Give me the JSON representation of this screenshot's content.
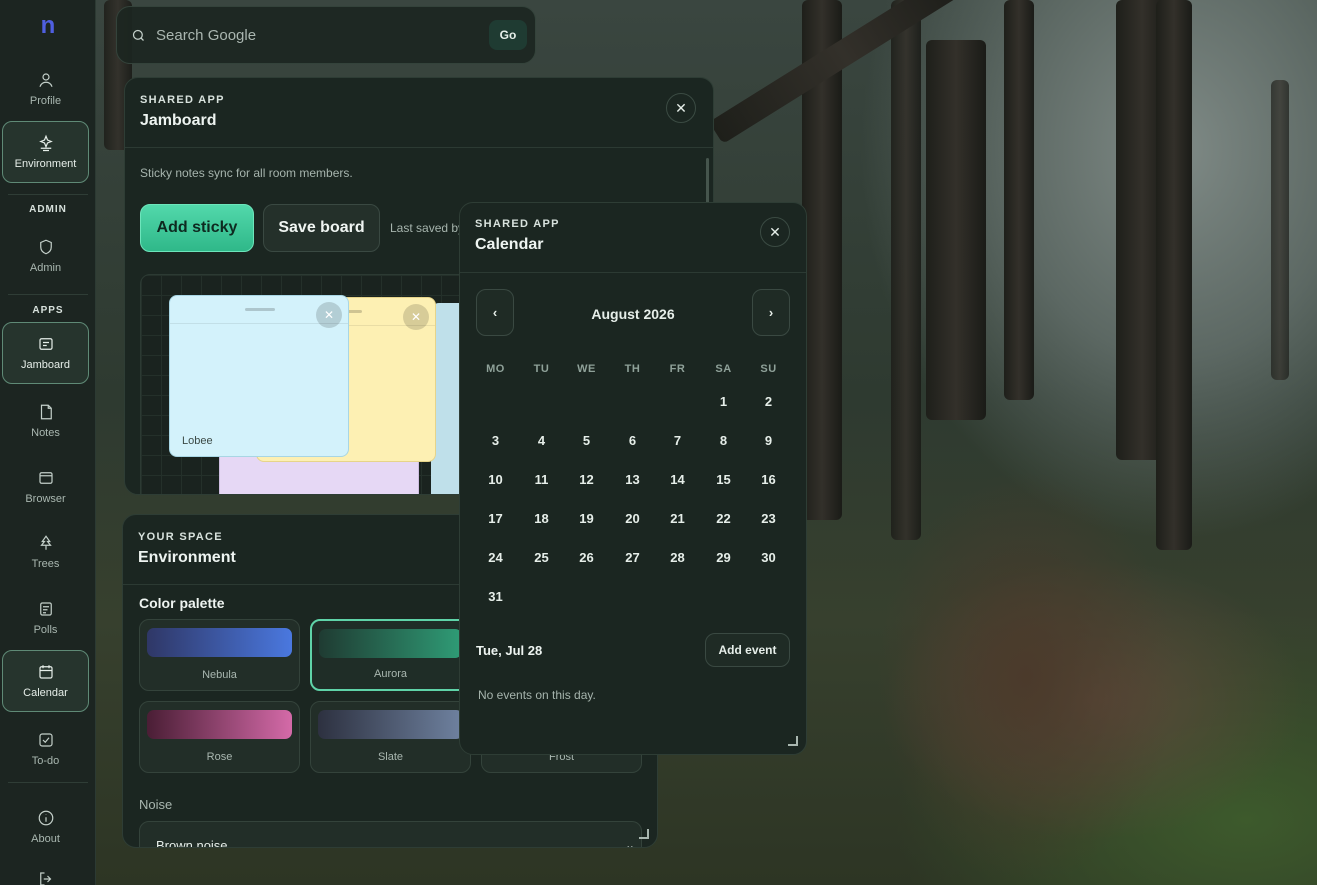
{
  "sidebar": {
    "logo": "n",
    "items": [
      {
        "label": "Profile",
        "icon": "user-icon"
      },
      {
        "label": "Environment",
        "icon": "sparkle-lamp-icon"
      },
      {
        "label": "Admin",
        "icon": "shield-icon"
      },
      {
        "label": "Jamboard",
        "icon": "board-icon"
      },
      {
        "label": "Notes",
        "icon": "note-icon"
      },
      {
        "label": "Browser",
        "icon": "browser-icon"
      },
      {
        "label": "Trees",
        "icon": "tree-icon"
      },
      {
        "label": "Polls",
        "icon": "poll-icon"
      },
      {
        "label": "Calendar",
        "icon": "calendar-icon"
      },
      {
        "label": "To-do",
        "icon": "checkbox-icon"
      },
      {
        "label": "About",
        "icon": "info-icon"
      }
    ],
    "sections": {
      "admin": "ADMIN",
      "apps": "APPS"
    }
  },
  "search": {
    "placeholder": "Search Google",
    "value": "",
    "go_label": "Go"
  },
  "jamboard": {
    "kicker": "SHARED APP",
    "title": "Jamboard",
    "description": "Sticky notes sync for all room members.",
    "add_label": "Add sticky",
    "save_label": "Save board",
    "last_saved": "Last saved by",
    "stickies": [
      {
        "author": "Lobee",
        "color": "#d3f2fb"
      },
      {
        "author": "",
        "color": "#fdf0b3"
      },
      {
        "author": "",
        "color": "#bfe0ea"
      },
      {
        "author": "",
        "color": "#e6d8f5"
      }
    ]
  },
  "environment": {
    "kicker": "YOUR SPACE",
    "title": "Environment",
    "palette_title": "Color palette",
    "palettes": [
      {
        "name": "Nebula",
        "from": "#2f3766",
        "to": "#4a78df",
        "selected": false
      },
      {
        "name": "Aurora",
        "from": "#1f3b32",
        "to": "#2f9c76",
        "selected": true
      },
      {
        "name": "",
        "from": "#2a3a36",
        "to": "#3b5a50",
        "selected": false
      },
      {
        "name": "Rose",
        "from": "#4a1e35",
        "to": "#d46aa8",
        "selected": false
      },
      {
        "name": "Slate",
        "from": "#2d3140",
        "to": "#6f82a0",
        "selected": false
      },
      {
        "name": "Frost",
        "from": "#2e3f44",
        "to": "#7fa3b0",
        "selected": false
      }
    ],
    "noise_label": "Noise",
    "noise_value": "Brown noise"
  },
  "calendar": {
    "kicker": "SHARED APP",
    "title": "Calendar",
    "prev": "‹",
    "next": "›",
    "month_label": "August 2026",
    "weekdays": [
      "MO",
      "TU",
      "WE",
      "TH",
      "FR",
      "SA",
      "SU"
    ],
    "first_weekday_index": 5,
    "days_in_month": 31,
    "selected_date_label": "Tue, Jul 28",
    "add_event_label": "Add event",
    "empty_message": "No events on this day."
  }
}
